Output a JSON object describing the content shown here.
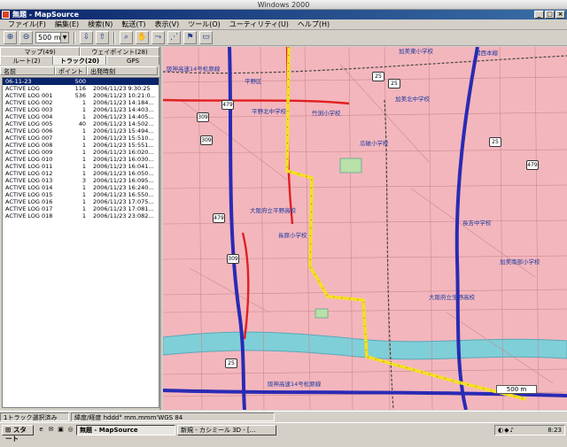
{
  "host": {
    "title": "Windows 2000"
  },
  "window": {
    "title": "無題 - MapSource"
  },
  "menu": [
    {
      "id": "file",
      "label": "ファイル(F)"
    },
    {
      "id": "edit",
      "label": "編集(E)"
    },
    {
      "id": "find",
      "label": "検索(N)"
    },
    {
      "id": "transfer",
      "label": "転送(T)"
    },
    {
      "id": "view",
      "label": "表示(V)"
    },
    {
      "id": "tools",
      "label": "ツール(O)"
    },
    {
      "id": "utility",
      "label": "ユーティリティ(U)"
    },
    {
      "id": "help",
      "label": "ヘルプ(H)"
    }
  ],
  "toolbar": {
    "zoom_value": "500 m"
  },
  "tabs_top": [
    {
      "id": "maps",
      "label": "マップ(49)"
    },
    {
      "id": "waypoints",
      "label": "ウェイポイント(28)"
    }
  ],
  "tabs_bottom": [
    {
      "id": "routes",
      "label": "ルート(2)"
    },
    {
      "id": "tracks",
      "label": "トラック(20)"
    },
    {
      "id": "gps",
      "label": "GPS"
    }
  ],
  "list": {
    "columns": {
      "name": "名前",
      "points": "ポイント",
      "time": "出発時刻"
    },
    "rows": [
      {
        "name": "06-11-23",
        "points": "500",
        "time": "",
        "selected": true
      },
      {
        "name": "ACTIVE LOG",
        "points": "116",
        "time": "2006/11/23 9:30:25"
      },
      {
        "name": "ACTIVE LOG 001",
        "points": "536",
        "time": "2006/11/23 10:21:0..."
      },
      {
        "name": "ACTIVE LOG 002",
        "points": "1",
        "time": "2006/11/23 14:184..."
      },
      {
        "name": "ACTIVE LOG 003",
        "points": "1",
        "time": "2006/11/23 14:403..."
      },
      {
        "name": "ACTIVE LOG 004",
        "points": "1",
        "time": "2006/11/23 14:405..."
      },
      {
        "name": "ACTIVE LOG 005",
        "points": "40",
        "time": "2006/11/23 14:502..."
      },
      {
        "name": "ACTIVE LOG 006",
        "points": "1",
        "time": "2006/11/23 15:494..."
      },
      {
        "name": "ACTIVE LOG 007",
        "points": "1",
        "time": "2006/11/23 15:510..."
      },
      {
        "name": "ACTIVE LOG 008",
        "points": "1",
        "time": "2006/11/23 15:551..."
      },
      {
        "name": "ACTIVE LOG 009",
        "points": "1",
        "time": "2006/11/23 16:020..."
      },
      {
        "name": "ACTIVE LOG 010",
        "points": "1",
        "time": "2006/11/23 16:030..."
      },
      {
        "name": "ACTIVE LOG 011",
        "points": "1",
        "time": "2006/11/23 16:041..."
      },
      {
        "name": "ACTIVE LOG 012",
        "points": "1",
        "time": "2006/11/23 16:050..."
      },
      {
        "name": "ACTIVE LOG 013",
        "points": "3",
        "time": "2006/11/23 16:095..."
      },
      {
        "name": "ACTIVE LOG 014",
        "points": "1",
        "time": "2006/11/23 16:240..."
      },
      {
        "name": "ACTIVE LOG 015",
        "points": "1",
        "time": "2006/11/23 16:550..."
      },
      {
        "name": "ACTIVE LOG 016",
        "points": "1",
        "time": "2006/11/23 17:075..."
      },
      {
        "name": "ACTIVE LOG 017",
        "points": "1",
        "time": "2006/11/23 17:081..."
      },
      {
        "name": "ACTIVE LOG 018",
        "points": "1",
        "time": "2006/11/23 23:082..."
      }
    ]
  },
  "map": {
    "labels": [
      {
        "id": "kanjo-label",
        "text": "阪神高速14号松原線"
      },
      {
        "id": "kintetsu-label",
        "text": "関西本線"
      },
      {
        "id": "hirano-label",
        "text": "平野区"
      },
      {
        "id": "school-1",
        "text": "平野北中学校"
      },
      {
        "id": "school-2",
        "text": "加美東小学校"
      },
      {
        "id": "school-3",
        "text": "加美北中学校"
      },
      {
        "id": "school-4",
        "text": "長吉中学校"
      },
      {
        "id": "school-5",
        "text": "大阪府立平野高校"
      },
      {
        "id": "school-6",
        "text": "長原小学校"
      },
      {
        "id": "school-7",
        "text": "大阪府立生野高校"
      },
      {
        "id": "school-8",
        "text": "瓜破小学校"
      },
      {
        "id": "school-9",
        "text": "加美南部小学校"
      },
      {
        "id": "school-10",
        "text": "竹渕小学校"
      },
      {
        "id": "river-label",
        "text": "阪神高速14号松原線"
      }
    ],
    "route_numbers": [
      "25",
      "479",
      "309",
      "25",
      "479",
      "309",
      "25",
      "479",
      "309",
      "25"
    ],
    "scale": "500 m"
  },
  "status": {
    "cells": [
      "1トラック選択済み",
      "緯度/経度 hddd° mm.mmm'WGS 84"
    ]
  },
  "taskbar": {
    "start": "スタート",
    "tasks": [
      {
        "id": "mapsource",
        "label": "無題 - MapSource",
        "active": true
      },
      {
        "id": "browser",
        "label": "新規 - カシミール 3D - [...",
        "active": false
      }
    ],
    "clock": "8:23"
  }
}
